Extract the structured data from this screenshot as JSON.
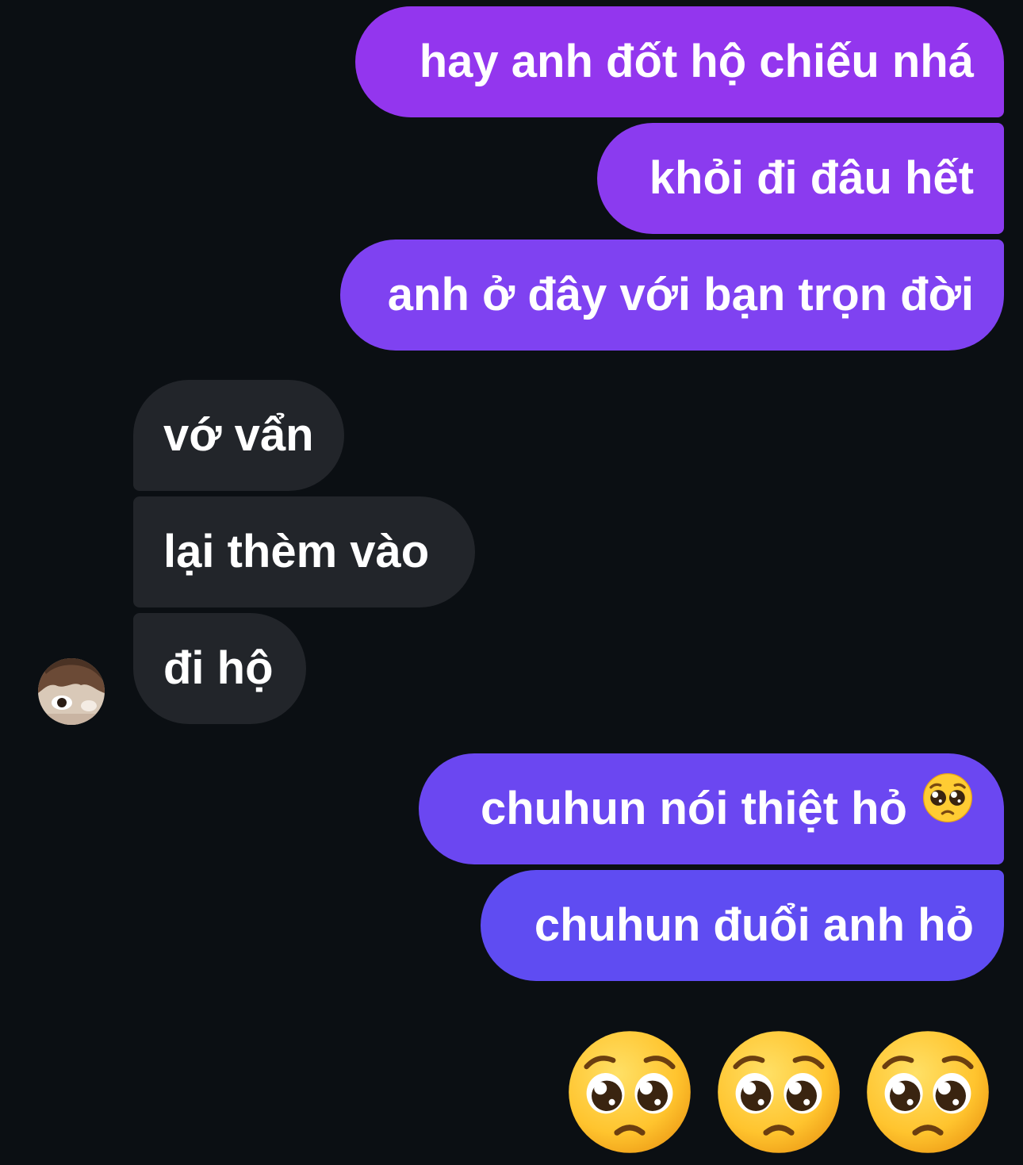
{
  "conversation": {
    "outgoing_1": [
      {
        "text": "hay anh đốt hộ chiếu nhá"
      },
      {
        "text": "khỏi đi đâu hết"
      },
      {
        "text": "anh ở đây với bạn trọn đời"
      }
    ],
    "incoming": [
      {
        "text": "vớ vẩn"
      },
      {
        "text": "lại thèm vào"
      },
      {
        "text": "đi hộ"
      }
    ],
    "outgoing_2": [
      {
        "text": "chuhun nói thiệt hỏ",
        "trailing_emoji": "pleading-face"
      },
      {
        "text": "chuhun đuổi anh hỏ"
      }
    ],
    "big_emoji_message": {
      "emojis": [
        "pleading-face",
        "pleading-face",
        "pleading-face"
      ]
    }
  },
  "sender_avatar": {
    "icon": "contact-photo"
  },
  "colors": {
    "background": "#0b0f13",
    "incoming_bubble": "#22252a",
    "outgoing_gradient_top": "#9336ee",
    "outgoing_gradient_bottom": "#5f4cf2",
    "text": "#ffffff"
  }
}
